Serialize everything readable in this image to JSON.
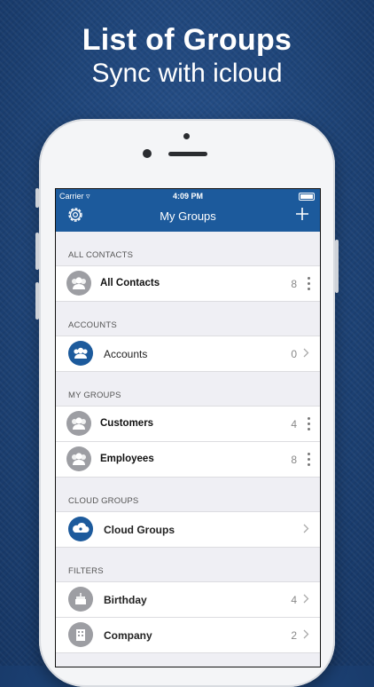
{
  "promo": {
    "title": "List of Groups",
    "subtitle": "Sync with icloud"
  },
  "status_bar": {
    "carrier": "Carrier",
    "time": "4:09 PM"
  },
  "nav": {
    "title": "My Groups"
  },
  "sections": {
    "all_contacts": {
      "header": "ALL CONTACTS",
      "row": {
        "label": "All Contacts",
        "count": "8"
      }
    },
    "accounts": {
      "header": "ACCOUNTS",
      "row": {
        "label": "Accounts",
        "count": "0"
      }
    },
    "my_groups": {
      "header": "MY GROUPS",
      "rows": [
        {
          "label": "Customers",
          "count": "4"
        },
        {
          "label": "Employees",
          "count": "8"
        }
      ]
    },
    "cloud_groups": {
      "header": "CLOUD GROUPS",
      "row": {
        "label": "Cloud Groups"
      }
    },
    "filters": {
      "header": "FILTERS",
      "rows": [
        {
          "label": "Birthday",
          "count": "4"
        },
        {
          "label": "Company",
          "count": "2"
        }
      ]
    }
  },
  "colors": {
    "accent": "#1c5a9c",
    "avatar_gray": "#9d9ea3"
  }
}
